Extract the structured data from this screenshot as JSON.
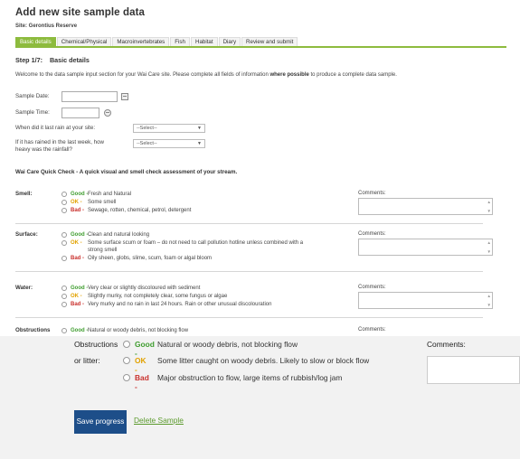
{
  "header": {
    "title": "Add new site sample data",
    "site_label": "Site: Gerontius Reserve"
  },
  "tabs": [
    {
      "label": "Basic details",
      "active": true
    },
    {
      "label": "Chemical/Physical",
      "active": false
    },
    {
      "label": "Macroinvertebrates",
      "active": false
    },
    {
      "label": "Fish",
      "active": false
    },
    {
      "label": "Habitat",
      "active": false
    },
    {
      "label": "Diary",
      "active": false
    },
    {
      "label": "Review and submit",
      "active": false
    }
  ],
  "step": {
    "number": "Step 1/7:",
    "name": "Basic details"
  },
  "intro": {
    "text_before": "Welcome to the data sample input section for your Wai Care site. Please complete all fields of information ",
    "bold": "where possible",
    "text_after": " to produce a complete data sample."
  },
  "form": {
    "sample_date_label": "Sample Date:",
    "sample_date_value": "",
    "sample_time_label": "Sample Time:",
    "sample_time_value": "",
    "last_rain_label": "When did it last rain at your site:",
    "last_rain_value": "--Select--",
    "heavy_rain_label_1": "If it has rained in the last week, how",
    "heavy_rain_label_2": "heavy was the rainfall?",
    "heavy_rain_value": "--Select--"
  },
  "quick_check": {
    "heading": "Wai Care Quick Check - A quick visual and smell check assessment of your stream."
  },
  "sections": {
    "smell": {
      "label": "Smell:",
      "comments_label": "Comments:",
      "options": [
        {
          "level": "Good -",
          "text": "Fresh and Natural"
        },
        {
          "level": "OK -",
          "text": "Some smell"
        },
        {
          "level": "Bad -",
          "text": "Sewage, rotten, chemical, petrol, detergent"
        }
      ]
    },
    "surface": {
      "label": "Surface:",
      "comments_label": "Comments:",
      "options": [
        {
          "level": "Good -",
          "text": "Clean and natural looking"
        },
        {
          "level": "OK -",
          "text": "Some surface scum or foam – do not need to call pollution hotline unless combined with a",
          "text2": "strong smell"
        },
        {
          "level": "Bad -",
          "text": "Oily sheen, globs, slime, scum, foam or algal bloom"
        }
      ]
    },
    "water": {
      "label": "Water:",
      "comments_label": "Comments:",
      "options": [
        {
          "level": "Good -",
          "text": "Very clear or slightly discoloured with sediment"
        },
        {
          "level": "OK -",
          "text": "Slightly murky, not completely clear, some fungus or algae"
        },
        {
          "level": "Bad -",
          "text": "Very murky and no rain in last 24 hours. Rain or other unusual discolouration"
        }
      ]
    },
    "obstructions_partial": {
      "label": "Obstructions",
      "comments_label": "Comments:",
      "level": "Good -",
      "text": "Natural or woody debris, not blocking flow"
    }
  },
  "zoomed": {
    "label_line1": "Obstructions",
    "label_line2": "or litter:",
    "comments_label": "Comments:",
    "options": [
      {
        "level": "Good -",
        "text": "Natural or woody debris, not blocking flow"
      },
      {
        "level": "OK -",
        "text": "Some litter caught on woody debris. Likely to slow or block flow"
      },
      {
        "level": "Bad -",
        "text": "Major obstruction to flow, large items of rubbish/log jam"
      }
    ]
  },
  "actions": {
    "save_label": "Save progress",
    "delete_label": "Delete Sample"
  },
  "colors": {
    "tab_active": "#8dbb3e",
    "good": "#3f9d2f",
    "ok": "#e2a200",
    "bad": "#c9302c",
    "save_button": "#1d4e89",
    "delete_link": "#5b9a2c"
  },
  "icons": {
    "date_picker": "calendar-icon",
    "time_picker": "clock-icon",
    "select_arrow": "chevron-down-icon",
    "option": "radio-icon"
  }
}
